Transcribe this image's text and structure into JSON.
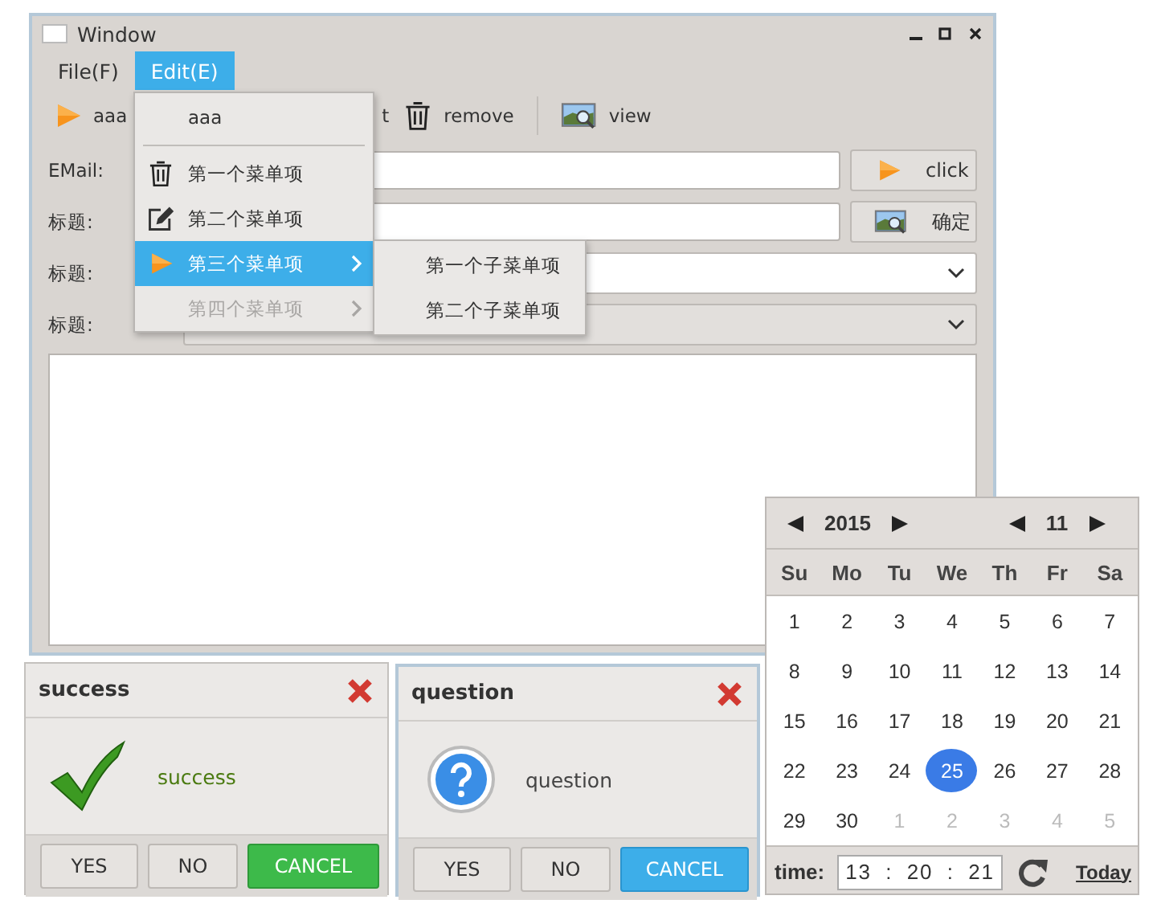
{
  "window": {
    "title": "Window"
  },
  "menu_bar": [
    {
      "label": "File(F)",
      "selected": false
    },
    {
      "label": "Edit(E)",
      "selected": true
    }
  ],
  "toolbar": [
    {
      "kind": "button",
      "label": "aaa"
    },
    {
      "kind": "button",
      "label": "t"
    },
    {
      "kind": "button",
      "label": "remove"
    },
    {
      "kind": "separator"
    },
    {
      "kind": "button",
      "label": "view"
    }
  ],
  "form": [
    {
      "label": "EMail:",
      "kind": "text",
      "button": {
        "label": "click"
      }
    },
    {
      "label": "标题:",
      "kind": "text",
      "button": {
        "label": "确定"
      }
    },
    {
      "label": "标题:",
      "kind": "combo",
      "editable": true
    },
    {
      "label": "标题:",
      "kind": "combo",
      "editable": false
    }
  ],
  "menu": {
    "items": [
      {
        "kind": "item",
        "label": "aaa",
        "selected": false,
        "disabled": false,
        "submenu": false
      },
      {
        "kind": "separator"
      },
      {
        "kind": "item",
        "label": "第一个菜单项",
        "selected": false,
        "disabled": false,
        "submenu": false
      },
      {
        "kind": "item",
        "label": "第二个菜单项",
        "selected": false,
        "disabled": false,
        "submenu": false
      },
      {
        "kind": "item",
        "label": "第三个菜单项",
        "selected": true,
        "disabled": false,
        "submenu": true
      },
      {
        "kind": "item",
        "label": "第四个菜单项",
        "selected": false,
        "disabled": true,
        "submenu": true
      }
    ],
    "submenu": [
      "第一个子菜单项",
      "第二个子菜单项"
    ]
  },
  "dialogs": [
    {
      "kind": "success",
      "title": "success",
      "message": "success",
      "buttons": [
        {
          "label": "YES",
          "default": false
        },
        {
          "label": "NO",
          "default": false
        },
        {
          "label": "CANCEL",
          "default": true
        }
      ]
    },
    {
      "kind": "question",
      "title": "question",
      "message": "question",
      "buttons": [
        {
          "label": "YES",
          "default": false
        },
        {
          "label": "NO",
          "default": false
        },
        {
          "label": "CANCEL",
          "default": true
        }
      ]
    }
  ],
  "calendar": {
    "year": "2015",
    "month": "11",
    "weekdays": [
      "Su",
      "Mo",
      "Tu",
      "We",
      "Th",
      "Fr",
      "Sa"
    ],
    "days": [
      {
        "label": "1",
        "outside": false,
        "selected": false
      },
      {
        "label": "2",
        "outside": false,
        "selected": false
      },
      {
        "label": "3",
        "outside": false,
        "selected": false
      },
      {
        "label": "4",
        "outside": false,
        "selected": false
      },
      {
        "label": "5",
        "outside": false,
        "selected": false
      },
      {
        "label": "6",
        "outside": false,
        "selected": false
      },
      {
        "label": "7",
        "outside": false,
        "selected": false
      },
      {
        "label": "8",
        "outside": false,
        "selected": false
      },
      {
        "label": "9",
        "outside": false,
        "selected": false
      },
      {
        "label": "10",
        "outside": false,
        "selected": false
      },
      {
        "label": "11",
        "outside": false,
        "selected": false
      },
      {
        "label": "12",
        "outside": false,
        "selected": false
      },
      {
        "label": "13",
        "outside": false,
        "selected": false
      },
      {
        "label": "14",
        "outside": false,
        "selected": false
      },
      {
        "label": "15",
        "outside": false,
        "selected": false
      },
      {
        "label": "16",
        "outside": false,
        "selected": false
      },
      {
        "label": "17",
        "outside": false,
        "selected": false
      },
      {
        "label": "18",
        "outside": false,
        "selected": false
      },
      {
        "label": "19",
        "outside": false,
        "selected": false
      },
      {
        "label": "20",
        "outside": false,
        "selected": false
      },
      {
        "label": "21",
        "outside": false,
        "selected": false
      },
      {
        "label": "22",
        "outside": false,
        "selected": false
      },
      {
        "label": "23",
        "outside": false,
        "selected": false
      },
      {
        "label": "24",
        "outside": false,
        "selected": false
      },
      {
        "label": "25",
        "outside": false,
        "selected": true
      },
      {
        "label": "26",
        "outside": false,
        "selected": false
      },
      {
        "label": "27",
        "outside": false,
        "selected": false
      },
      {
        "label": "28",
        "outside": false,
        "selected": false
      },
      {
        "label": "29",
        "outside": false,
        "selected": false
      },
      {
        "label": "30",
        "outside": false,
        "selected": false
      },
      {
        "label": "1",
        "outside": true,
        "selected": false
      },
      {
        "label": "2",
        "outside": true,
        "selected": false
      },
      {
        "label": "3",
        "outside": true,
        "selected": false
      },
      {
        "label": "4",
        "outside": true,
        "selected": false
      },
      {
        "label": "5",
        "outside": true,
        "selected": false
      }
    ],
    "time": {
      "label": "time:",
      "parts": [
        "13",
        ":",
        "20",
        ":",
        "21"
      ]
    },
    "today": "Today"
  }
}
